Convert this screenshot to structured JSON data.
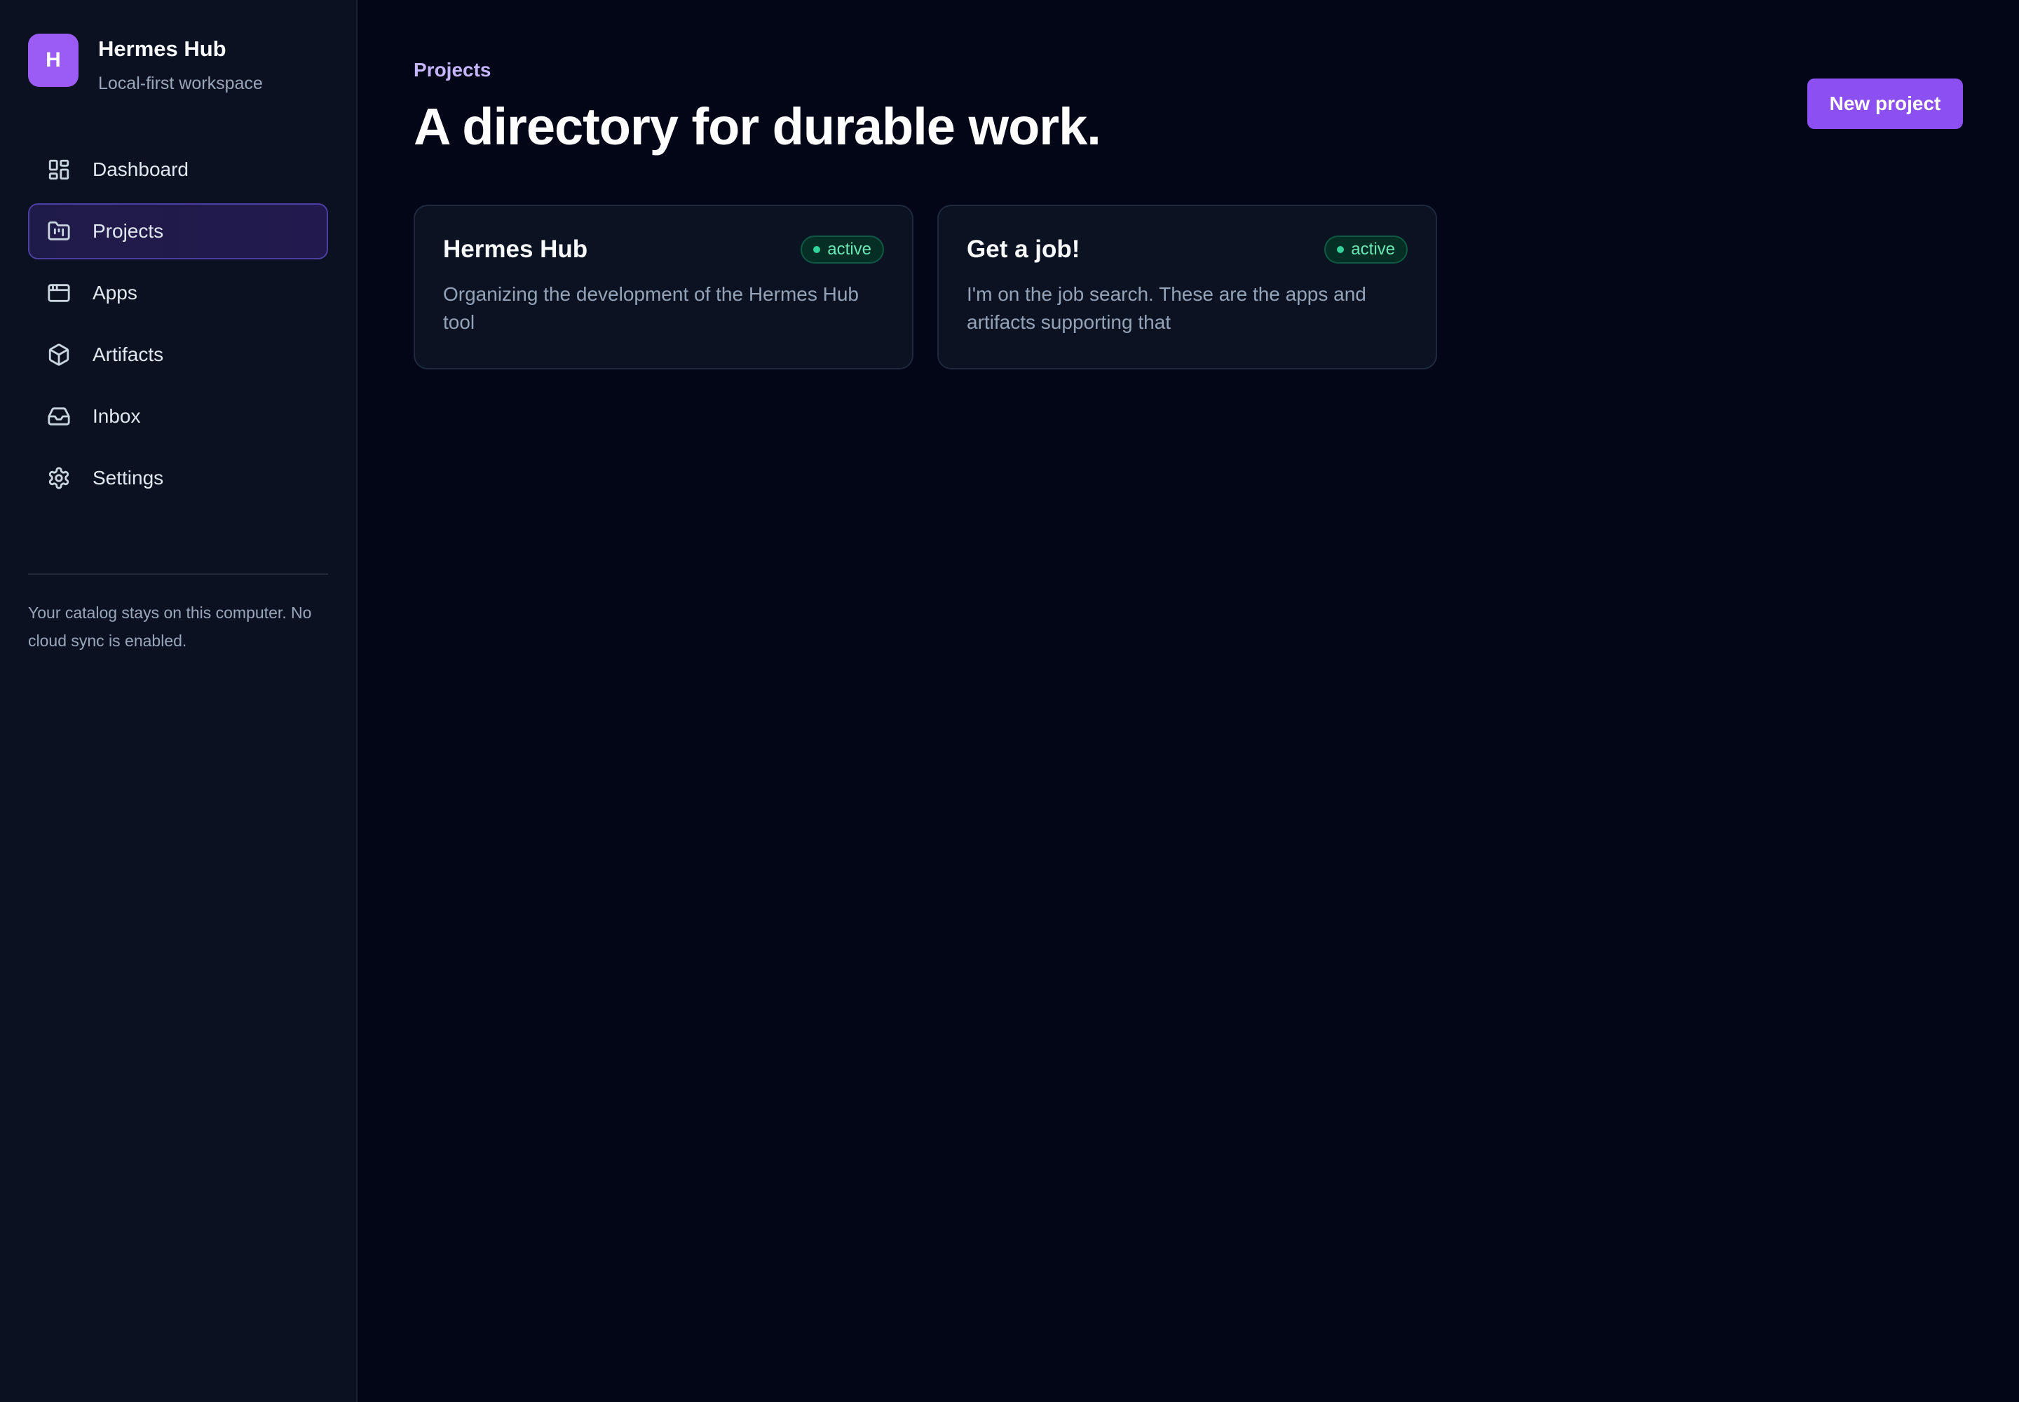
{
  "brand": {
    "logo_letter": "H",
    "name": "Hermes Hub",
    "subtitle": "Local-first workspace"
  },
  "sidebar": {
    "items": [
      {
        "label": "Dashboard",
        "icon": "dashboard-icon",
        "active": false
      },
      {
        "label": "Projects",
        "icon": "folder-icon",
        "active": true
      },
      {
        "label": "Apps",
        "icon": "app-window-icon",
        "active": false
      },
      {
        "label": "Artifacts",
        "icon": "box-icon",
        "active": false
      },
      {
        "label": "Inbox",
        "icon": "inbox-icon",
        "active": false
      },
      {
        "label": "Settings",
        "icon": "gear-icon",
        "active": false
      }
    ],
    "note": "Your catalog stays on this computer. No cloud sync is enabled."
  },
  "header": {
    "eyebrow": "Projects",
    "title": "A directory for durable work.",
    "new_button_label": "New project"
  },
  "projects": [
    {
      "name": "Hermes Hub",
      "status": "active",
      "description": "Organizing the development of the Hermes Hub tool"
    },
    {
      "name": "Get a job!",
      "status": "active",
      "description": "I'm on the job search. These are the apps and artifacts supporting that"
    }
  ],
  "colors": {
    "accent": "#8b4ff2",
    "background": "#020617",
    "sidebar_bg": "#0b1120",
    "status_active": "#34d399"
  }
}
